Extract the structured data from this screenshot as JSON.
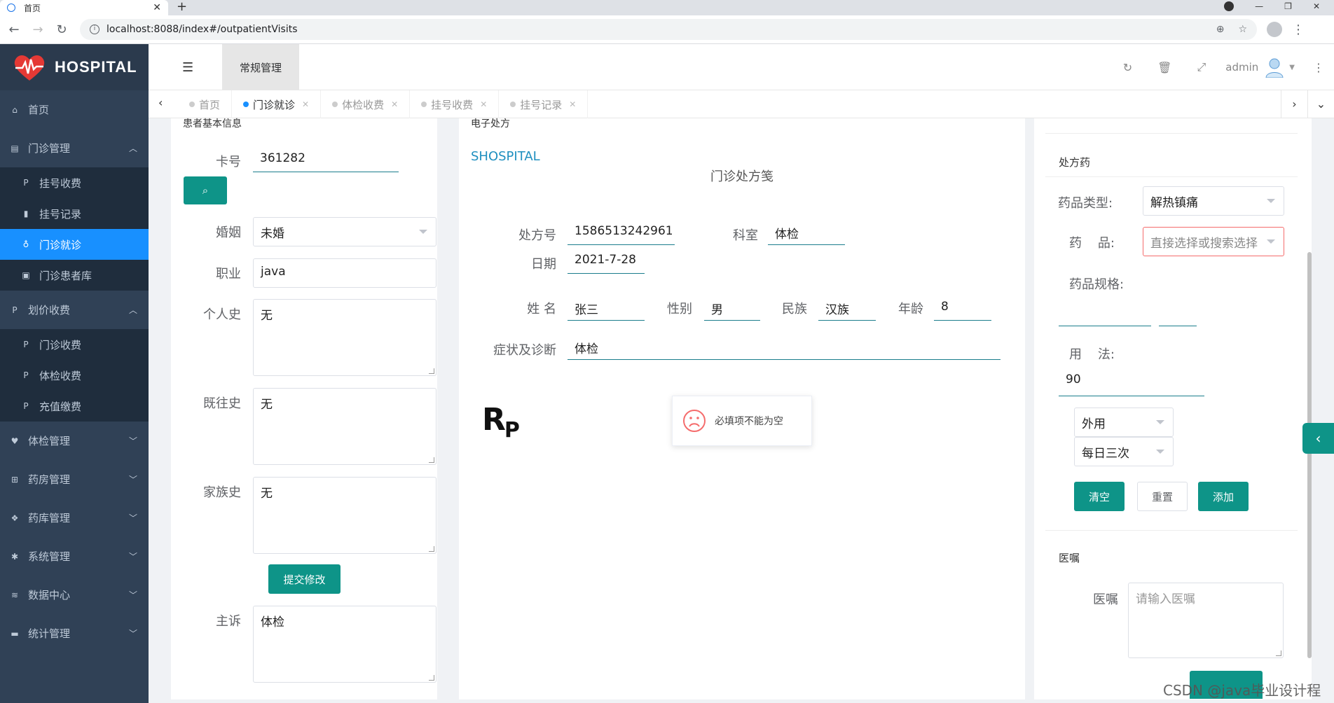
{
  "browser": {
    "tab_title": "首页",
    "new_tab": "+",
    "url": "localhost:8088/index#/outpatientVisits"
  },
  "sidebar": {
    "brand": "HOSPITAL",
    "items": [
      {
        "label": "首页",
        "icon": "home-icon"
      },
      {
        "label": "门诊管理",
        "icon": "clipboard-icon",
        "expanded": true,
        "children": [
          {
            "label": "挂号收费",
            "icon": "paypal-icon"
          },
          {
            "label": "挂号记录",
            "icon": "book-icon"
          },
          {
            "label": "门诊就诊",
            "icon": "stethoscope-icon",
            "active": true
          },
          {
            "label": "门诊患者库",
            "icon": "id-card-icon"
          }
        ]
      },
      {
        "label": "划价收费",
        "icon": "paypal-icon",
        "expanded": true,
        "children": [
          {
            "label": "门诊收费",
            "icon": "paypal-icon"
          },
          {
            "label": "体检收费",
            "icon": "paypal-icon"
          },
          {
            "label": "充值缴费",
            "icon": "paypal-icon"
          }
        ]
      },
      {
        "label": "体检管理",
        "icon": "heartbeat-icon"
      },
      {
        "label": "药房管理",
        "icon": "plus-square-icon"
      },
      {
        "label": "药库管理",
        "icon": "cubes-icon"
      },
      {
        "label": "系统管理",
        "icon": "gear-icon"
      },
      {
        "label": "数据中心",
        "icon": "database-icon"
      },
      {
        "label": "统计管理",
        "icon": "desktop-icon"
      }
    ]
  },
  "navbar": {
    "breadcrumb": "常规管理",
    "username": "admin"
  },
  "tags": [
    {
      "label": "首页",
      "active": false
    },
    {
      "label": "门诊就诊",
      "active": true
    },
    {
      "label": "体检收费",
      "active": false
    },
    {
      "label": "挂号收费",
      "active": false
    },
    {
      "label": "挂号记录",
      "active": false
    }
  ],
  "patient": {
    "header": "患者基本信息",
    "card_label": "卡号",
    "card_value": "361282",
    "marriage_label": "婚姻",
    "marriage_value": "未婚",
    "job_label": "职业",
    "job_value": "java",
    "personal_history_label": "个人史",
    "personal_history_value": "无",
    "past_history_label": "既往史",
    "past_history_value": "无",
    "family_history_label": "家族史",
    "family_history_value": "无",
    "submit_label": "提交修改",
    "complaint_label": "主诉",
    "complaint_value": "体检"
  },
  "prescription": {
    "header": "电子处方",
    "hospital": "SHOSPITAL",
    "title": "门诊处方笺",
    "no_label": "处方号",
    "no_value": "1586513242961",
    "dept_label": "科室",
    "dept_value": "体检",
    "date_label": "日期",
    "date_value": "2021-7-28",
    "name_label": "姓 名",
    "name_value": "张三",
    "gender_label": "性别",
    "gender_value": "男",
    "ethnic_label": "民族",
    "ethnic_value": "汉族",
    "age_label": "年龄",
    "age_value": "8",
    "diagnosis_label": "症状及诊断",
    "diagnosis_value": "体检",
    "rp_main": "R",
    "rp_sub": "P",
    "toast_message": "必填项不能为空"
  },
  "drugs": {
    "header": "处方药",
    "type_label": "药品类型:",
    "type_value": "解热镇痛",
    "drug_label": "药    品:",
    "drug_placeholder": "直接选择或搜索选择",
    "spec_label": "药品规格:",
    "usage_label": "用    法:",
    "usage_value": "90",
    "route_value": "外用",
    "freq_value": "每日三次",
    "btn_clear": "清空",
    "btn_reset": "重置",
    "btn_add": "添加",
    "advice_header": "医嘱",
    "advice_label": "医嘱",
    "advice_placeholder": "请输入医嘱"
  },
  "watermark": "CSDN @java毕业设计程序",
  "colors": {
    "sidebar_bg": "#304156",
    "submenu_bg": "#1f2d3d",
    "active_blue": "#1890ff",
    "teal": "#0e9488",
    "error_red": "#f56c6c"
  }
}
